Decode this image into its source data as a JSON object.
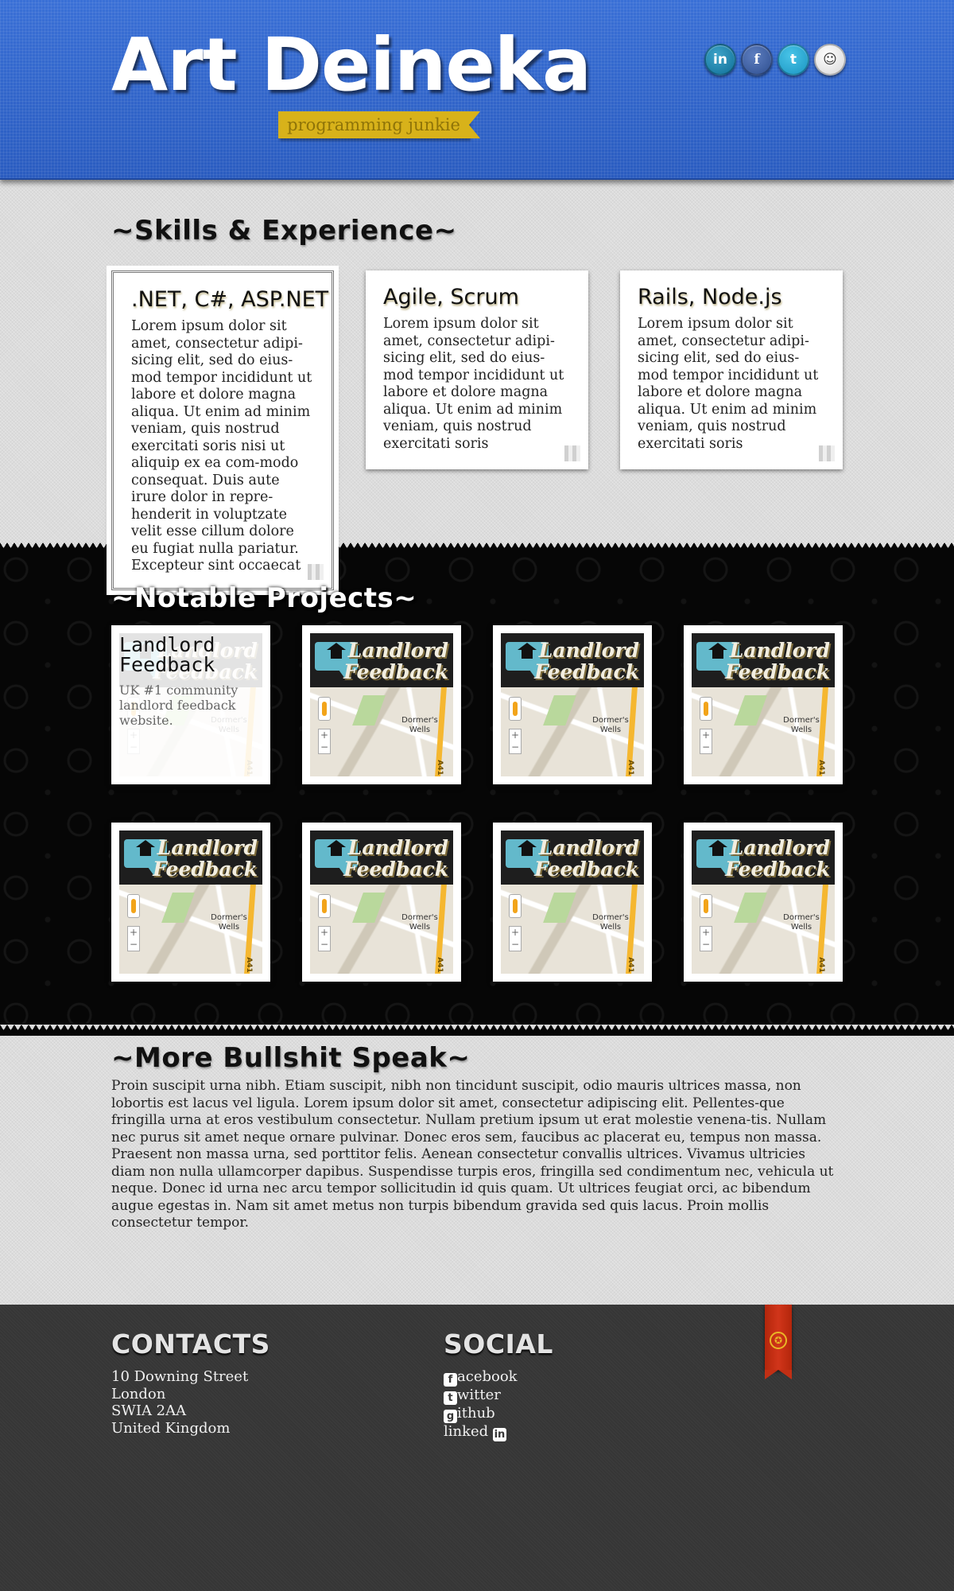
{
  "header": {
    "title": "Art Deineka",
    "tagline": "programming junkie",
    "social": [
      {
        "name": "linkedin",
        "glyph": "in"
      },
      {
        "name": "facebook",
        "glyph": "f"
      },
      {
        "name": "twitter",
        "glyph": "t"
      },
      {
        "name": "github",
        "glyph": "☺"
      }
    ],
    "colors": {
      "header_blue": "#2e63c8",
      "tagline_gold": "#d8b21a"
    }
  },
  "skills": {
    "heading": "~Skills & Experience~",
    "cards": [
      {
        "title": ".NET, C#, ASP.NET",
        "text": "Lorem ipsum dolor sit amet, consectetur adipi-sicing elit, sed do eius-mod tempor incididunt ut labore et dolore magna aliqua. Ut enim ad minim veniam, quis nostrud exercitati soris nisi ut aliquip ex ea com-modo consequat. Duis aute irure dolor in repre-henderit in voluptzate velit esse cillum dolore eu fugiat nulla pariatur. Excepteur sint occaecat"
      },
      {
        "title": "Agile, Scrum",
        "text": "Lorem ipsum dolor sit amet, consectetur adipi-sicing elit, sed do eius-mod tempor incididunt ut labore et dolore magna aliqua. Ut enim ad minim veniam, quis nostrud exercitati soris"
      },
      {
        "title": "Rails, Node.js",
        "text": "Lorem ipsum dolor sit amet, consectetur adipi-sicing elit, sed do eius-mod tempor incididunt ut labore et dolore magna aliqua. Ut enim ad minim veniam, quis nostrud exercitati soris"
      }
    ]
  },
  "projects": {
    "heading": "~Notable Projects~",
    "thumb": {
      "logo_line1": "Landlord",
      "logo_line2": "Feedback",
      "map_label": "Dormer's Wells",
      "road_label": "A41",
      "zoom": "+ −"
    },
    "hovered": {
      "title": "Landlord Feedback",
      "description": "UK #1 community landlord feedback website."
    }
  },
  "more": {
    "heading": "~More Bullshit Speak~",
    "text": "Proin suscipit urna nibh. Etiam suscipit, nibh non tincidunt suscipit, odio mauris ultrices massa, non lobortis est lacus vel ligula. Lorem ipsum dolor sit amet, consectetur adipiscing elit. Pellentes-que fringilla urna at eros vestibulum consectetur. Nullam pretium ipsum ut erat molestie venena-tis. Nullam nec purus sit amet neque ornare pulvinar. Donec eros sem, faucibus ac placerat eu, tempus non massa. Praesent non massa urna, sed porttitor felis. Aenean consectetur convallis ultrices. Vivamus ultricies diam non nulla ullamcorper dapibus. Suspendisse turpis eros, fringilla sed condimentum nec, vehicula ut neque. Donec id urna nec arcu tempor sollicitudin id quis quam. Ut ultrices feugiat orci, ac bibendum augue egestas in. Nam sit amet metus non turpis bibendum gravida sed quis lacus. Proin mollis consectetur tempor."
  },
  "footer": {
    "contacts_heading": "CONTACTS",
    "address": [
      "10 Downing Street",
      "London",
      "SWIA 2AA",
      "United Kingdom"
    ],
    "social_heading": "SOCIAL",
    "links": [
      {
        "icon": "f",
        "text": "acebook"
      },
      {
        "icon": "t",
        "text": "witter"
      },
      {
        "icon": "g",
        "text": "ithub"
      },
      {
        "prefix": "linked",
        "icon": "in"
      }
    ],
    "ribbon_glyph": "✪",
    "colors": {
      "footer_bg": "#363636",
      "ribbon_red": "#c22f14"
    }
  }
}
